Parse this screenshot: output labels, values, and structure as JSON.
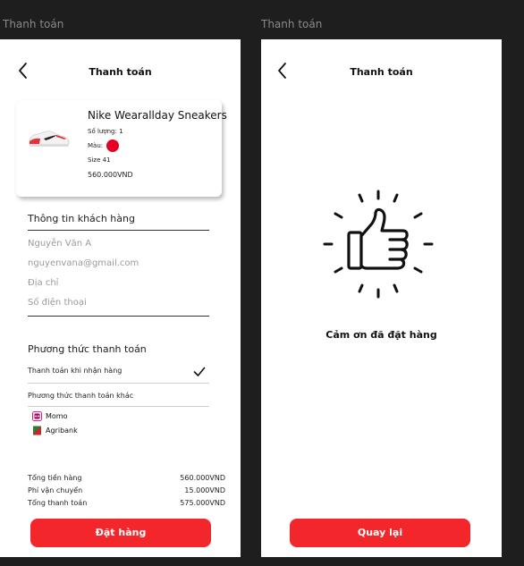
{
  "frames": {
    "frame1_label": "Thanh toán",
    "frame2_label": "Thanh toán"
  },
  "checkout": {
    "title": "Thanh toán",
    "product": {
      "name": "Nike Wearallday Sneakers",
      "quantity": "Số lượng: 1",
      "color_label": "Màu:",
      "color": "#e60023",
      "size": "Size 41",
      "price": "560.000VND"
    },
    "customer": {
      "heading": "Thông tin khách hàng",
      "name_placeholder": "Nguyễn Văn A",
      "email_placeholder": "nguyenvana@gmail.com",
      "address_placeholder": "Địa chỉ",
      "phone_placeholder": "Số điện thoại"
    },
    "payment": {
      "heading": "Phương thức thanh toán",
      "cod": "Thanh toán khi nhận hàng",
      "other": "Phương thức thanh toán khác",
      "options": [
        {
          "label": "Momo",
          "icon": "momo-logo-icon"
        },
        {
          "label": "Agribank",
          "icon": "agribank-logo-icon"
        }
      ]
    },
    "summary": {
      "subtotal_label": "Tổng tiền hàng",
      "subtotal_value": "560.000VND",
      "shipping_label": "Phí vận chuyển",
      "shipping_value": "15.000VND",
      "total_label": "Tổng thanh toán",
      "total_value": "575.000VND"
    },
    "order_button": "Đặt hàng"
  },
  "success": {
    "title": "Thanh toán",
    "message": "Cảm ơn đã đặt hàng",
    "back_button": "Quay lại",
    "icon": "thumbs-up-icon"
  },
  "colors": {
    "accent": "#f3262b",
    "background": "#1e1e1e"
  }
}
